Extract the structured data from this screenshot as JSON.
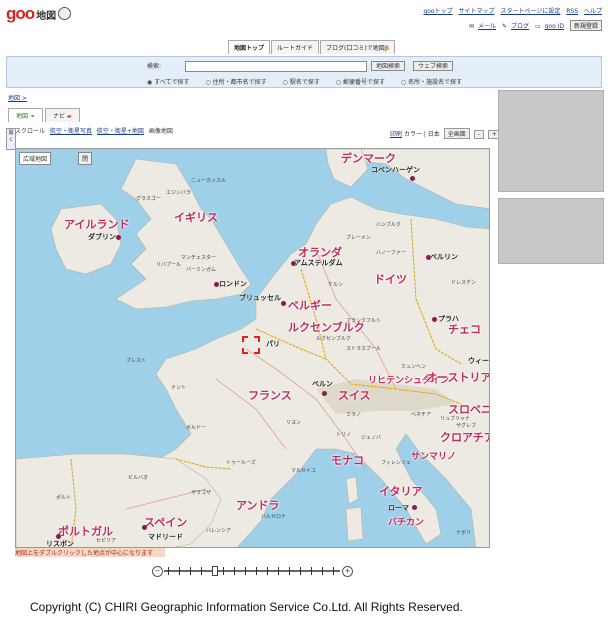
{
  "header": {
    "logo_text": "goo",
    "logo_sub": "地図",
    "top_links": [
      "gooトップ",
      "サイトマップ",
      "スタートページに設定",
      "RSS",
      "ヘルプ"
    ],
    "user_links": [
      "メール",
      "ブログ",
      "goo ID"
    ],
    "register_label": "新規登録"
  },
  "tabs": [
    "地図トップ",
    "ルートガイド",
    "ブログ(口コミ)で地図"
  ],
  "tab_badge": "β",
  "search": {
    "label": "検索:",
    "input_value": "",
    "map_search_button": "地図検索",
    "web_search_button": "ウェブ検索",
    "options": [
      "すべてで探す",
      "住所・都市名で探す",
      "駅名で探す",
      "郵便番号で探す",
      "名所・施設名で探す"
    ],
    "selected_option": "すべてで探す"
  },
  "breadcrumb": "地図 >",
  "map_tabs": [
    "地図",
    "ナビ"
  ],
  "toolbar": {
    "scroll_label": "スクロール",
    "aerial_photo": "航空・衛星写真",
    "aerial_map": "航空・衛星+地図",
    "image_map": "画像地図"
  },
  "print_label": "印刷",
  "color_label": "カラー",
  "japan_label": "日本",
  "wide_area_label": "全画面",
  "zoom_out_symbol": "-",
  "zoom_in_symbol": "+",
  "map_overlay": {
    "wide_label": "広域地図",
    "wide_button": "閉"
  },
  "side_tab_label": "開く",
  "map": {
    "countries": [
      "デンマーク",
      "アイルランド",
      "イギリス",
      "オランダ",
      "ドイツ",
      "ベルギー",
      "ルクセンブルク",
      "チェコ",
      "フランス",
      "スイス",
      "リヒテンシュタイン",
      "オーストリア",
      "スロベニア",
      "クロアチア",
      "サンマリノ",
      "モナコ",
      "イタリア",
      "アンドラ",
      "スペイン",
      "ポルトガル",
      "バチカン"
    ],
    "cities": [
      "コペンハーゲン",
      "ダブリン",
      "ロンドン",
      "アムステルダム",
      "ブリュッセル",
      "ベルリン",
      "プラハ",
      "パリ",
      "ベルン",
      "ウィーン",
      "リュブリャナ",
      "ザグレブ",
      "ローマ",
      "マドリード",
      "リスボン",
      "ミュンヘン",
      "ミラノ",
      "ハンブルク"
    ],
    "minor_labels": [
      "グラスゴー",
      "エジンバラ",
      "マンチェスター",
      "バーミンガム",
      "リバプール",
      "ブレスト",
      "ナント",
      "ボルドー",
      "リヨン",
      "マルセイユ",
      "トゥールーズ",
      "バルセロナ",
      "ビルバオ",
      "ポルト",
      "セビリア",
      "フランクフルト",
      "ケルン",
      "ハノーファー",
      "ニューカッスル",
      "ルクセンブルク",
      "ストラスブール",
      "トリノ",
      "ジェノバ",
      "フィレンツェ",
      "ベネチア",
      "ナポリ",
      "ザラゴザ",
      "バレンシア",
      "ブレーメン",
      "ドレスデン"
    ]
  },
  "map_notice": "地図上をダブルクリックした地点が中心になります",
  "copyright": "Copyright (C) CHIRI Geographic Information Service Co.Ltd. All Rights Reserved.",
  "colors": {
    "logo": "#d9231d",
    "country": "#c22a5a",
    "sea": "#9fd0ea",
    "land": "#eceae2"
  }
}
